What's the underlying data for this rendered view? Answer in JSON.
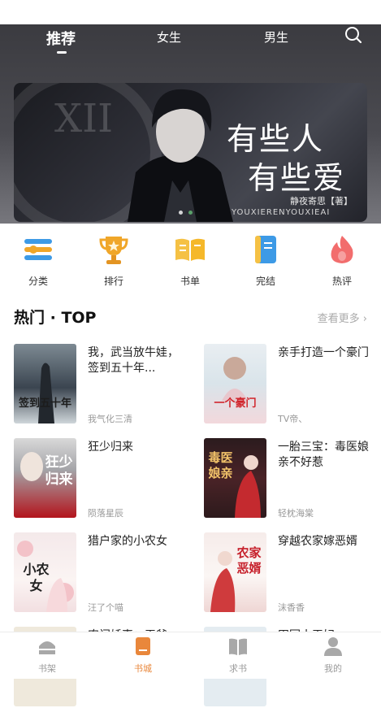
{
  "tabs": [
    {
      "label": "推荐",
      "active": true
    },
    {
      "label": "女生",
      "active": false
    },
    {
      "label": "男生",
      "active": false
    }
  ],
  "banner": {
    "title_line1": "有些人",
    "title_line2": "有些爱",
    "author": "静夜寄思【著】",
    "subtitle": "YOUXIERENYOUXIEAI",
    "slides": 2,
    "active_slide": 2
  },
  "categories": [
    {
      "label": "分类",
      "icon": "list-icon",
      "color": "#4aa3e8"
    },
    {
      "label": "排行",
      "icon": "trophy-icon",
      "color": "#f0a629"
    },
    {
      "label": "书单",
      "icon": "open-book-icon",
      "color": "#f5c144"
    },
    {
      "label": "完结",
      "icon": "book-icon",
      "color": "#4aa3e8"
    },
    {
      "label": "热评",
      "icon": "flame-icon",
      "color": "#f26d6d"
    }
  ],
  "section": {
    "title": "热门 · TOP",
    "more": "查看更多"
  },
  "books": [
    {
      "title": "我，武当放牛娃，签到五十年...",
      "author": "我气化三清",
      "cover_text": "签到五十年"
    },
    {
      "title": "亲手打造一个豪门",
      "author": "TV帝、",
      "cover_text": "一个豪门"
    },
    {
      "title": "狂少归来",
      "author": "陨落星辰",
      "cover_text": "狂少归来"
    },
    {
      "title": "一胎三宝：毒医娘亲不好惹",
      "author": "轻枕海棠",
      "cover_text": "毒医娘亲"
    },
    {
      "title": "猎户家的小农女",
      "author": "汪了个喵",
      "cover_text": "小农女"
    },
    {
      "title": "穿越农家嫁恶婿",
      "author": "沫香香",
      "cover_text": "农家恶婿"
    }
  ],
  "partial_books": [
    {
      "title": "农门娇妻：王爷..."
    },
    {
      "title": "田园小王妃"
    }
  ],
  "bottom_nav": [
    {
      "label": "书架",
      "icon": "bookshelf-icon",
      "active": false
    },
    {
      "label": "书城",
      "icon": "bookstore-icon",
      "active": true
    },
    {
      "label": "求书",
      "icon": "request-book-icon",
      "active": false
    },
    {
      "label": "我的",
      "icon": "profile-icon",
      "active": false
    }
  ],
  "colors": {
    "accent": "#e9873b",
    "active_dot": "#5aa06a"
  }
}
